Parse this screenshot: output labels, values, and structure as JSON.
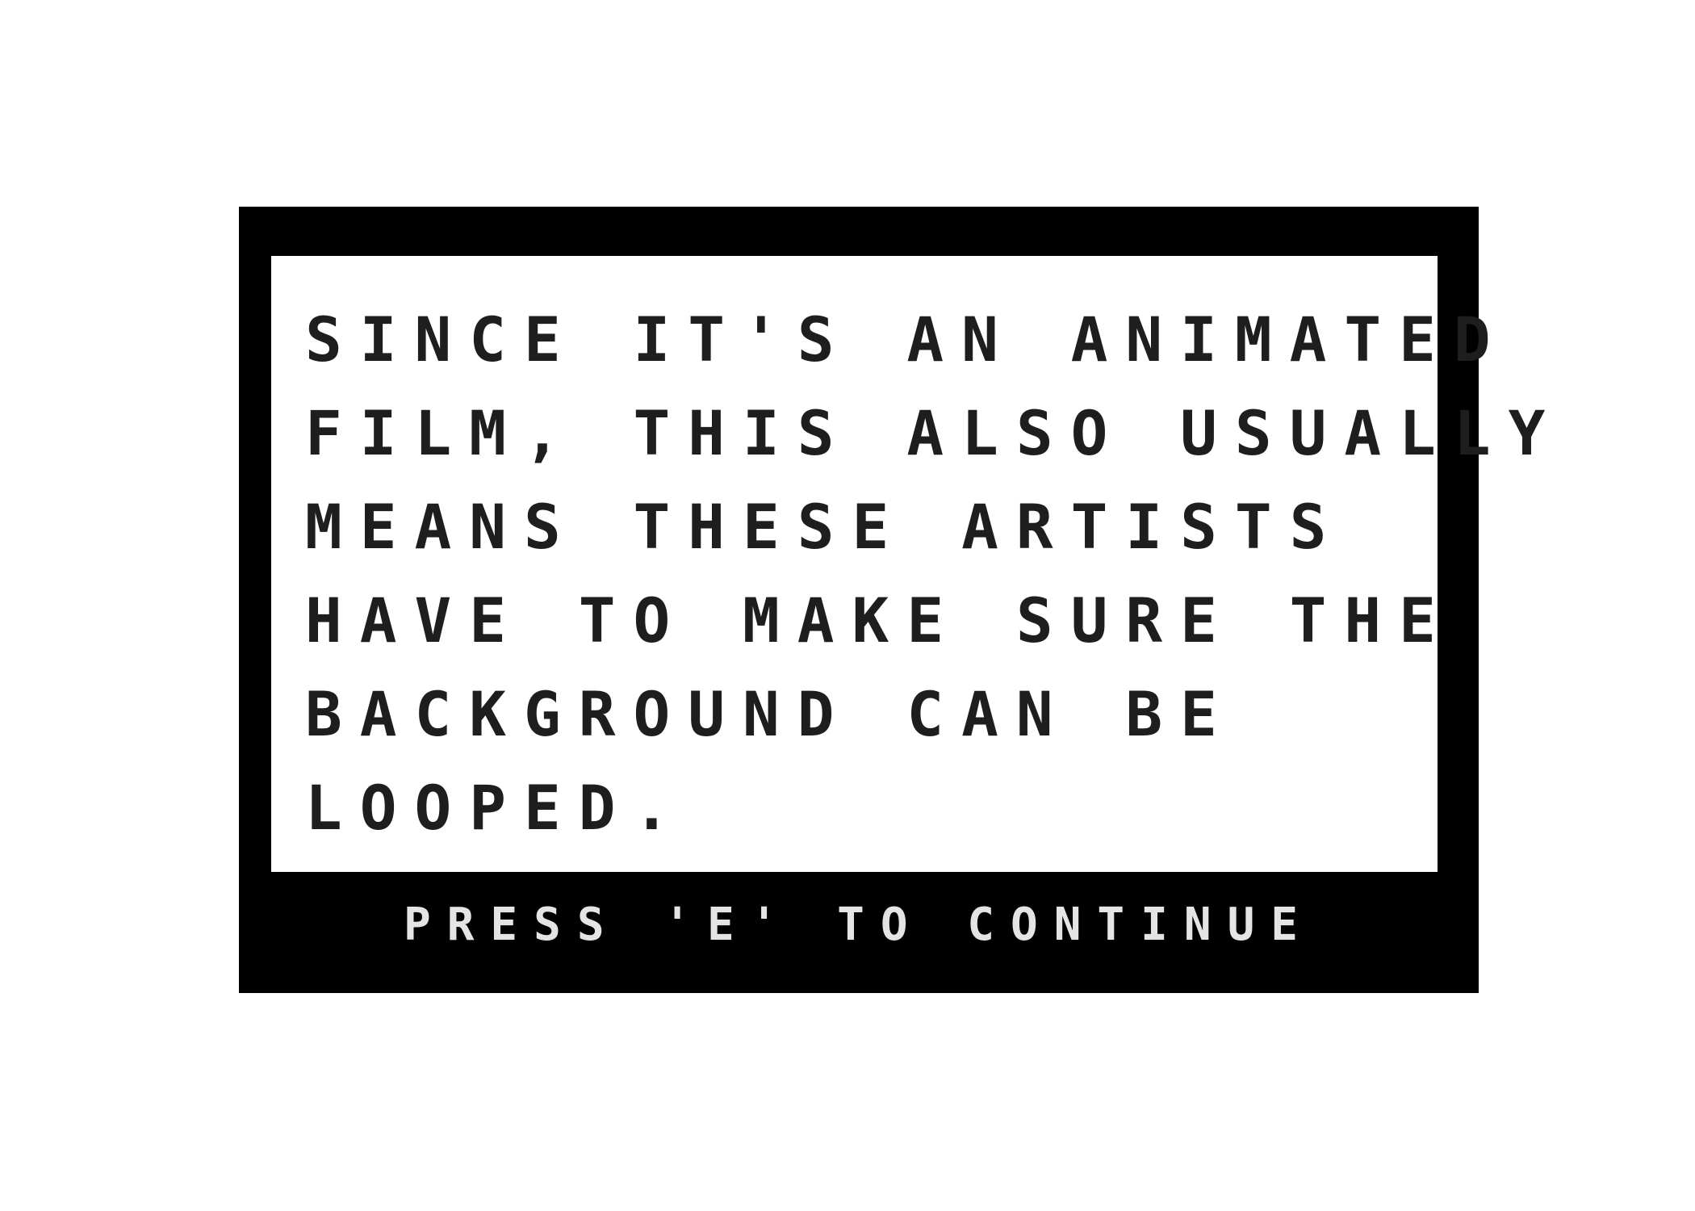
{
  "dialog": {
    "lines": [
      "SINCE IT'S AN ANIMATED",
      "FILM, THIS ALSO USUALLY",
      "MEANS THESE ARTISTS",
      "HAVE TO MAKE SURE THE",
      "BACKGROUND CAN BE",
      "LOOPED."
    ],
    "continue_prompt": "PRESS 'E' TO CONTINUE"
  },
  "colors": {
    "frame": "#000000",
    "panel": "#ffffff",
    "text": "#1e1e1e",
    "prompt_text": "#e4e4e4"
  }
}
